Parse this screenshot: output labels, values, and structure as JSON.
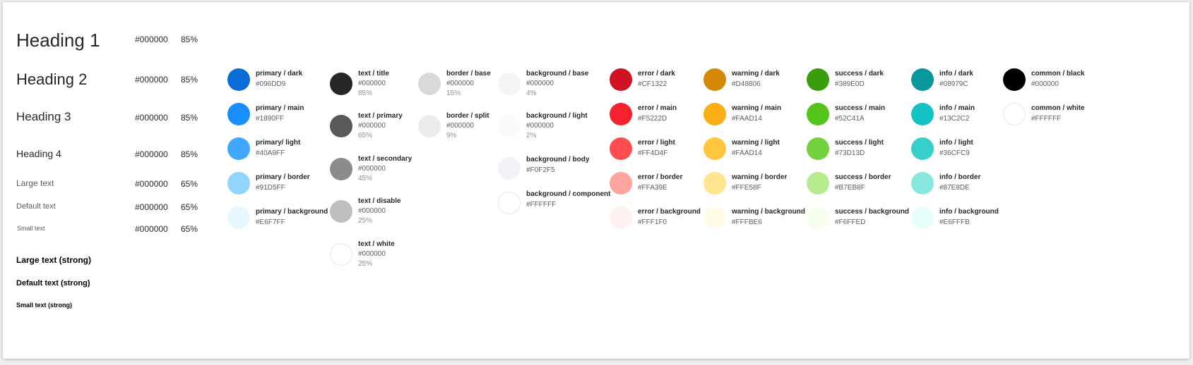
{
  "typography": [
    {
      "label": "Heading 1",
      "color": "#000000",
      "alpha": "85%"
    },
    {
      "label": "Heading 2",
      "color": "#000000",
      "alpha": "85%"
    },
    {
      "label": "Heading 3",
      "color": "#000000",
      "alpha": "85%"
    },
    {
      "label": "Heading 4",
      "color": "#000000",
      "alpha": "85%"
    },
    {
      "label": "Large text",
      "color": "#000000",
      "alpha": "65%"
    },
    {
      "label": "Default text",
      "color": "#000000",
      "alpha": "65%"
    },
    {
      "label": "Small text",
      "color": "#000000",
      "alpha": "65%"
    },
    {
      "label": "Large text (strong)"
    },
    {
      "label": "Default text (strong)"
    },
    {
      "label": "Small text (strong)"
    }
  ],
  "palette": {
    "primary": [
      {
        "name": "primary / dark",
        "hex": "#096DD9",
        "swatch": "#096DD9"
      },
      {
        "name": "primary / main",
        "hex": "#1890FF",
        "swatch": "#1890FF"
      },
      {
        "name": "primary/ light",
        "hex": "#40A9FF",
        "swatch": "#40A9FF"
      },
      {
        "name": "primary / border",
        "hex": "#91D5FF",
        "swatch": "#91D5FF"
      },
      {
        "name": "primary / background",
        "hex": "#E6F7FF",
        "swatch": "#E6F7FF"
      }
    ],
    "text": [
      {
        "name": "text / title",
        "hex": "#000000",
        "alpha": "85%",
        "swatch": "#262626"
      },
      {
        "name": "text / primary",
        "hex": "#000000",
        "alpha": "65%",
        "swatch": "#595959"
      },
      {
        "name": "text / secondary",
        "hex": "#000000",
        "alpha": "45%",
        "swatch": "#8c8c8c"
      },
      {
        "name": "text / disable",
        "hex": "#000000",
        "alpha": "25%",
        "swatch": "#bfbfbf"
      },
      {
        "name": "text / white",
        "hex": "#000000",
        "alpha": "25%",
        "swatch": "#FFFFFF"
      }
    ],
    "border": [
      {
        "name": "border / base",
        "hex": "#000000",
        "alpha": "15%",
        "swatch": "#d9d9d9"
      },
      {
        "name": "border / split",
        "hex": "#000000",
        "alpha": "9%",
        "swatch": "#e8e8e8"
      }
    ],
    "background": [
      {
        "name": "background / base",
        "hex": "#000000",
        "alpha": "4%",
        "swatch": "#f5f5f5"
      },
      {
        "name": "background / light",
        "hex": "#000000",
        "alpha": "2%",
        "swatch": "#fafafa"
      },
      {
        "name": "background / body",
        "hex": "#F0F2F5",
        "swatch": "#F0F2F5"
      },
      {
        "name": "background / component",
        "hex": "#FFFFFF",
        "swatch": "#FFFFFF"
      }
    ],
    "error": [
      {
        "name": "error / dark",
        "hex": "#CF1322",
        "swatch": "#CF1322"
      },
      {
        "name": "error / main",
        "hex": "#F5222D",
        "swatch": "#F5222D"
      },
      {
        "name": "error / light",
        "hex": "#FF4D4F",
        "swatch": "#FF4D4F"
      },
      {
        "name": "error / border",
        "hex": "#FFA39E",
        "swatch": "#FFA39E"
      },
      {
        "name": "error / background",
        "hex": "#FFF1F0",
        "swatch": "#FFF1F0"
      }
    ],
    "warning": [
      {
        "name": "warning / dark",
        "hex": "#D48806",
        "swatch": "#D48806"
      },
      {
        "name": "warning / main",
        "hex": "#FAAD14",
        "swatch": "#FAAD14"
      },
      {
        "name": "warning / light",
        "hex": "#FAAD14",
        "swatch": "#FFC53D"
      },
      {
        "name": "warning / border",
        "hex": "#FFE58F",
        "swatch": "#FFE58F"
      },
      {
        "name": "warning / background",
        "hex": "#FFFBE6",
        "swatch": "#FFFBE6"
      }
    ],
    "success": [
      {
        "name": "success / dark",
        "hex": "#389E0D",
        "swatch": "#389E0D"
      },
      {
        "name": "success / main",
        "hex": "#52C41A",
        "swatch": "#52C41A"
      },
      {
        "name": "success / light",
        "hex": "#73D13D",
        "swatch": "#73D13D"
      },
      {
        "name": "success / border",
        "hex": "#B7EB8F",
        "swatch": "#B7EB8F"
      },
      {
        "name": "success / background",
        "hex": "#F6FFED",
        "swatch": "#F6FFED"
      }
    ],
    "info": [
      {
        "name": "info / dark",
        "hex": "#08979C",
        "swatch": "#08979C"
      },
      {
        "name": "info / main",
        "hex": "#13C2C2",
        "swatch": "#13C2C2"
      },
      {
        "name": "info / light",
        "hex": "#36CFC9",
        "swatch": "#36CFC9"
      },
      {
        "name": "info / border",
        "hex": "#87E8DE",
        "swatch": "#87E8DE"
      },
      {
        "name": "info / background",
        "hex": "#E6FFFB",
        "swatch": "#E6FFFB"
      }
    ],
    "common": [
      {
        "name": "common / black",
        "hex": "#000000",
        "swatch": "#000000"
      },
      {
        "name": "common / white",
        "hex": "#FFFFFF",
        "swatch": "#FFFFFF"
      }
    ]
  }
}
